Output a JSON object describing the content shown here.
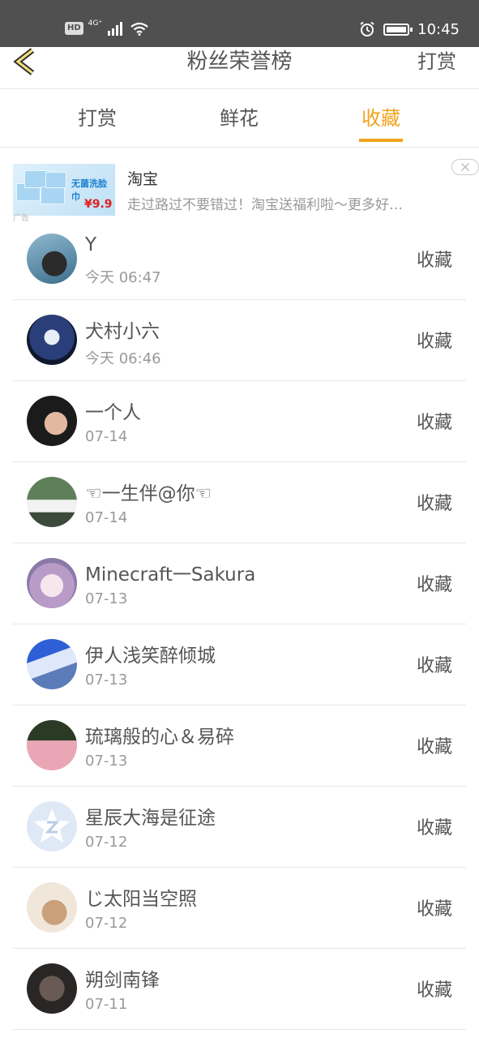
{
  "status_bar": {
    "hd": "HD",
    "network": "4G⁺",
    "time": "10:45"
  },
  "header": {
    "title": "粉丝荣誉榜",
    "action": "打赏"
  },
  "tabs": [
    {
      "label": "打赏",
      "active": false
    },
    {
      "label": "鲜花",
      "active": false
    },
    {
      "label": "收藏",
      "active": true
    }
  ],
  "ad": {
    "thumb_title": "无菌洗脸巾",
    "thumb_price": "¥9.9",
    "label": "广告",
    "brand": "淘宝",
    "description": "走过路过不要错过！淘宝送福利啦～更多好…"
  },
  "list": [
    {
      "name": "Y",
      "time": "今天 06:47",
      "action": "收藏"
    },
    {
      "name": "犬村小六",
      "time": "今天 06:46",
      "action": "收藏"
    },
    {
      "name": "一个人",
      "time": "07-14",
      "action": "收藏"
    },
    {
      "name": "☜一生伴@你☜",
      "time": "07-14",
      "action": "收藏"
    },
    {
      "name": "Minecraft一Sakura",
      "time": "07-13",
      "action": "收藏"
    },
    {
      "name": "伊人浅笑醉倾城",
      "time": "07-13",
      "action": "收藏"
    },
    {
      "name": "琉璃般的心＆易碎",
      "time": "07-13",
      "action": "收藏"
    },
    {
      "name": "星辰大海是征途",
      "time": "07-12",
      "action": "收藏"
    },
    {
      "name": "じ太阳当空照",
      "time": "07-12",
      "action": "收藏"
    },
    {
      "name": "朔剑南锋",
      "time": "07-11",
      "action": "收藏"
    }
  ],
  "colors": {
    "accent": "#f0a41c",
    "status_bar": "#505050",
    "text": "#555555",
    "muted": "#999999"
  }
}
